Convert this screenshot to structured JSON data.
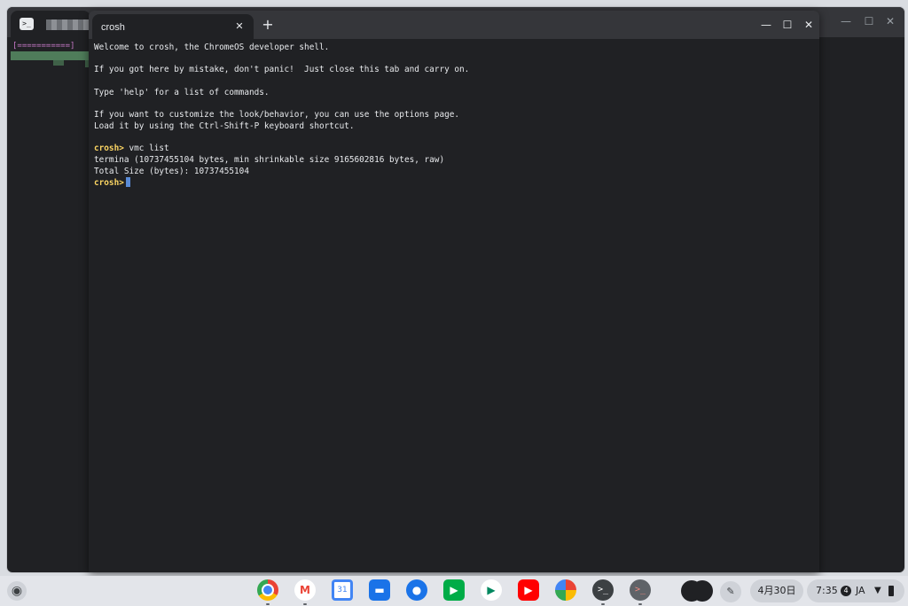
{
  "background_window": {
    "progress_text": "[===========]",
    "close_glyph": "✕",
    "maximize_glyph": "☐",
    "minimize_glyph": "—"
  },
  "crosh_window": {
    "tab_title": "crosh",
    "tab_close_glyph": "✕",
    "new_tab_glyph": "+",
    "minimize_glyph": "—",
    "maximize_glyph": "☐",
    "close_glyph": "✕"
  },
  "terminal": {
    "welcome": "Welcome to crosh, the ChromeOS developer shell.",
    "mistake": "If you got here by mistake, don't panic!  Just close this tab and carry on.",
    "help": "Type 'help' for a list of commands.",
    "customize": "If you want to customize the look/behavior, you can use the options page.",
    "shortcut": "Load it by using the Ctrl-Shift-P keyboard shortcut.",
    "prompt": "crosh>",
    "command": " vmc list",
    "output1": "termina (10737455104 bytes, min shrinkable size 9165602816 bytes, raw)",
    "output2": "Total Size (bytes): 10737455104"
  },
  "shelf": {
    "apps": [
      {
        "name": "chrome",
        "icon": "chrome-icon",
        "color": "#ea4335"
      },
      {
        "name": "gmail",
        "icon": "gmail-icon",
        "color": "#ffffff"
      },
      {
        "name": "calendar",
        "icon": "calendar-icon",
        "color": "#4285f4",
        "label": "31"
      },
      {
        "name": "files",
        "icon": "files-icon",
        "color": "#1a73e8"
      },
      {
        "name": "messages",
        "icon": "messages-icon",
        "color": "#1a73e8"
      },
      {
        "name": "meet",
        "icon": "meet-icon",
        "color": "#00ac47"
      },
      {
        "name": "play-store",
        "icon": "play-store-icon",
        "color": "#01875f"
      },
      {
        "name": "youtube",
        "icon": "youtube-icon",
        "color": "#ff0000"
      },
      {
        "name": "photos",
        "icon": "photos-icon",
        "color": "#fbbc04"
      },
      {
        "name": "terminal",
        "icon": "terminal-icon",
        "color": "#3c4043",
        "label": ">_"
      },
      {
        "name": "crosh",
        "icon": "crosh-icon",
        "color": "#5f6368",
        "label": ">_"
      }
    ],
    "date": "4月30日",
    "clock": "7:35",
    "notification_count": "4",
    "ime": "JA"
  }
}
